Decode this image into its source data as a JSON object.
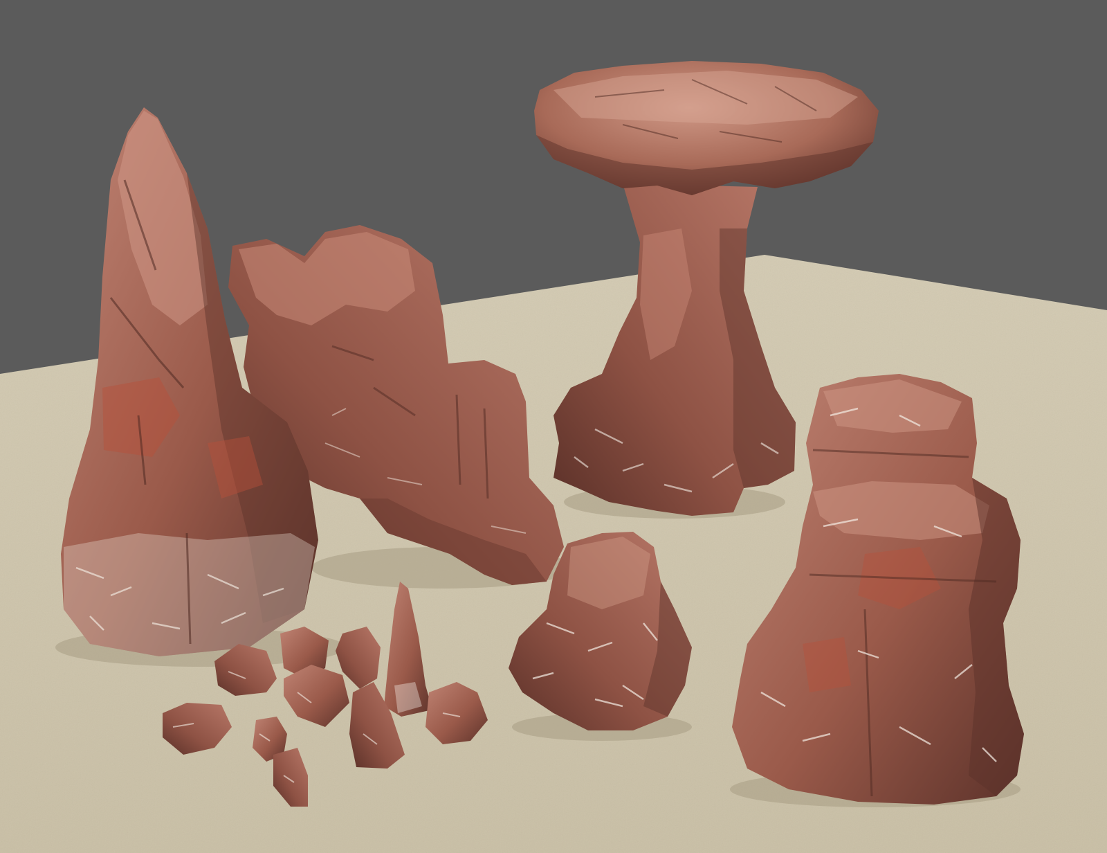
{
  "scene": {
    "colors": {
      "background": "#5b5b5b",
      "sand": "#cfc6ae",
      "sand_shadow": "#b8ad92",
      "rock_base": "#9a5a4a",
      "rock_light": "#c08474",
      "rock_dark": "#5c322a",
      "rock_red": "#b8503a",
      "vein": "#efe6dc"
    },
    "objects": [
      "tall-spire-rock",
      "long-ridge-rock",
      "mushroom-pillar-rock",
      "stacked-boulder-rock",
      "medium-lumpy-rock",
      "small-pebble-cluster"
    ]
  }
}
